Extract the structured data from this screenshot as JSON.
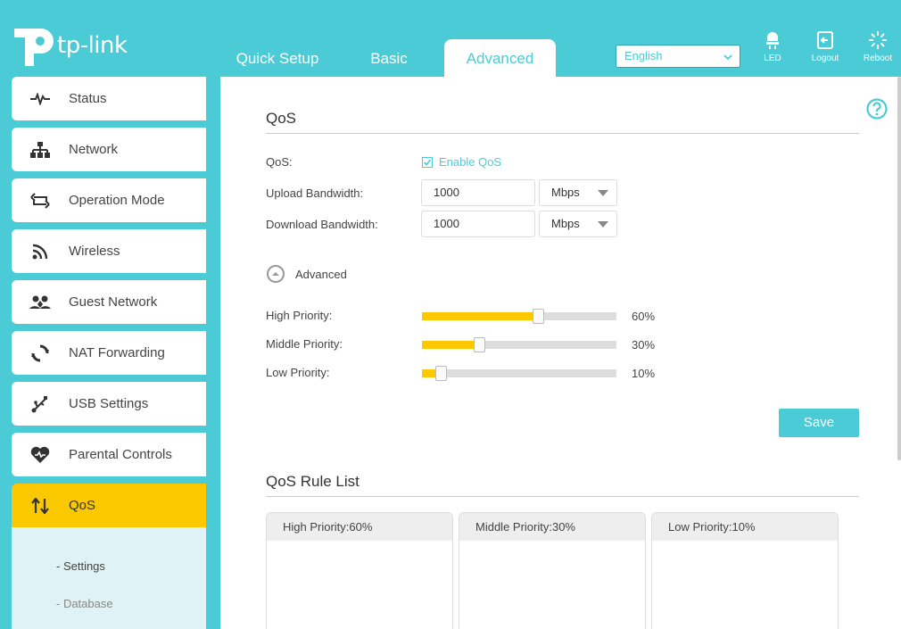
{
  "header": {
    "logo_text": "tp-link",
    "tabs": [
      {
        "label": "Quick Setup"
      },
      {
        "label": "Basic"
      },
      {
        "label": "Advanced"
      }
    ],
    "language": "English",
    "buttons": {
      "led": "LED",
      "logout": "Logout",
      "reboot": "Reboot"
    }
  },
  "sidebar": {
    "items": [
      {
        "label": "Status",
        "icon": "status-icon"
      },
      {
        "label": "Network",
        "icon": "network-icon"
      },
      {
        "label": "Operation Mode",
        "icon": "operation-mode-icon"
      },
      {
        "label": "Wireless",
        "icon": "wireless-icon"
      },
      {
        "label": "Guest Network",
        "icon": "guest-network-icon"
      },
      {
        "label": "NAT Forwarding",
        "icon": "nat-forwarding-icon"
      },
      {
        "label": "USB Settings",
        "icon": "usb-icon"
      },
      {
        "label": "Parental Controls",
        "icon": "heart-icon"
      },
      {
        "label": "QoS",
        "icon": "qos-icon"
      }
    ],
    "active": "QoS",
    "sub_items": [
      {
        "label": "- Settings"
      },
      {
        "label": "- Database"
      }
    ]
  },
  "qos": {
    "title": "QoS",
    "qos_label": "QoS:",
    "enable_label": "Enable QoS",
    "enabled": true,
    "upload_label": "Upload Bandwidth:",
    "upload_value": "1000",
    "upload_unit": "Mbps",
    "download_label": "Download Bandwidth:",
    "download_value": "1000",
    "download_unit": "Mbps",
    "advanced_label": "Advanced",
    "priorities": [
      {
        "label": "High Priority:",
        "value_text": "60%",
        "value": 0.6
      },
      {
        "label": "Middle Priority:",
        "value_text": "30%",
        "value": 0.3
      },
      {
        "label": "Low Priority:",
        "value_text": "10%",
        "value": 0.1
      }
    ],
    "save_label": "Save"
  },
  "rule_list": {
    "title": "QoS Rule List",
    "panels": [
      {
        "label": "High Priority:60%"
      },
      {
        "label": "Middle Priority:30%"
      },
      {
        "label": "Low Priority:10%"
      }
    ]
  },
  "colors": {
    "accent": "#4acbd6",
    "active": "#fcc800"
  }
}
